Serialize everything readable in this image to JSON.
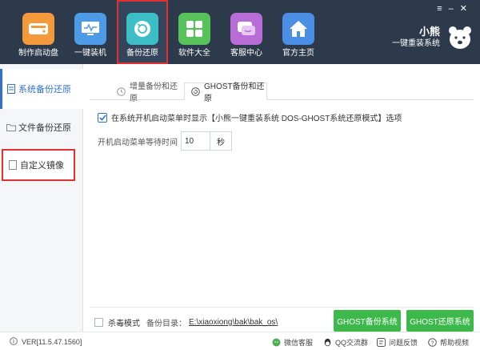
{
  "window": {
    "controls": [
      "≡",
      "–",
      "✕"
    ]
  },
  "nav": [
    {
      "label": "制作启动盘",
      "icon": "disk-icon",
      "color": "#f39a3d"
    },
    {
      "label": "一键装机",
      "icon": "monitor-icon",
      "color": "#4d9be6"
    },
    {
      "label": "备份还原",
      "icon": "restore-icon",
      "color": "#3dbdc5"
    },
    {
      "label": "软件大全",
      "icon": "grid-icon",
      "color": "#58c25a"
    },
    {
      "label": "客服中心",
      "icon": "chat-icon",
      "color": "#b86dd6"
    },
    {
      "label": "官方主页",
      "icon": "home-icon",
      "color": "#4b8ee6"
    }
  ],
  "brand": {
    "name": "小熊",
    "tagline": "一键重装系统"
  },
  "sidebar": {
    "items": [
      {
        "label": "系统备份还原"
      },
      {
        "label": "文件备份还原"
      },
      {
        "label": "自定义镜像"
      }
    ]
  },
  "tabs": [
    {
      "label": "增量备份和还原"
    },
    {
      "label": "GHOST备份和还原"
    }
  ],
  "ghost": {
    "menu_option": "在系统开机启动菜单时显示【小熊一键重装系统 DOS-GHOST系统还原模式】选项",
    "wait_label": "开机启动菜单等待时间",
    "wait_value": "10",
    "wait_unit": "秒"
  },
  "bottom": {
    "antivirus_label": "杀毒模式",
    "backup_dir_label": "备份目录：",
    "backup_dir_path": "E:\\xiaoxiong\\bak\\bak_os\\",
    "backup_button": "GHOST备份系统",
    "restore_button": "GHOST还原系统"
  },
  "status": {
    "version": "VER[11.5.47.1560]",
    "links": [
      "微信客服",
      "QQ交流群",
      "问题反馈",
      "帮助视频"
    ]
  },
  "colors": {
    "accent": "#2f6fd6",
    "header_bg": "#2d3a4b",
    "green": "#3cb94a",
    "highlight": "#e03131"
  }
}
